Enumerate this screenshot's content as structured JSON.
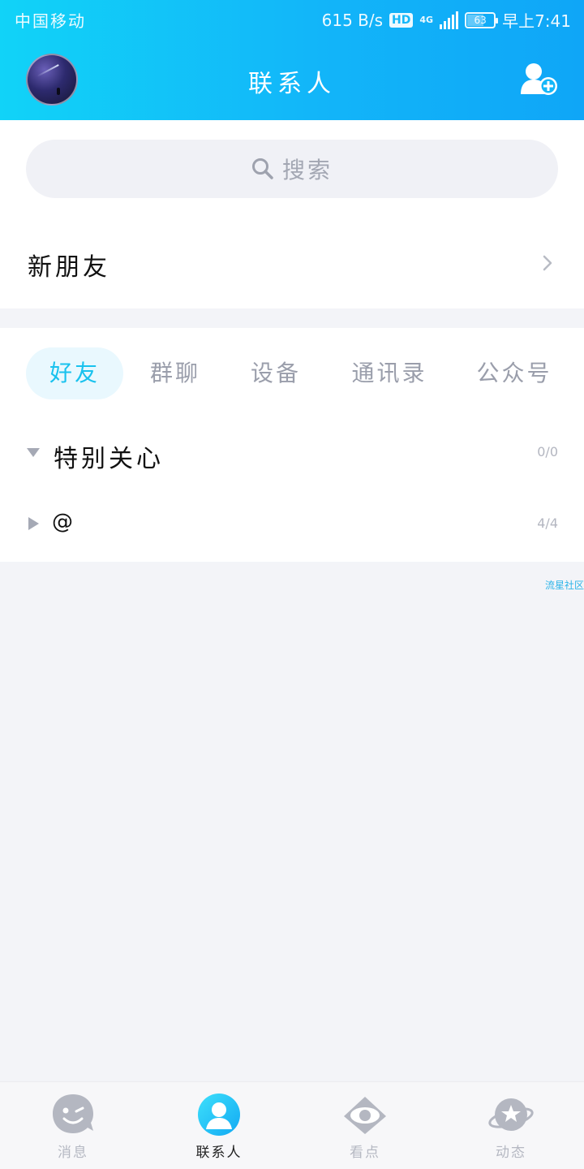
{
  "status_bar": {
    "carrier": "中国移动",
    "speed": "615 B/s",
    "hd": "HD",
    "network": "4G",
    "battery": "63",
    "time": "早上7:41"
  },
  "header": {
    "title": "联系人",
    "avatar_icon": "user-avatar",
    "add_icon": "add-contact-icon"
  },
  "search": {
    "placeholder": "搜索",
    "icon": "search-icon"
  },
  "new_friends": {
    "label": "新朋友"
  },
  "tabs": [
    {
      "label": "好友",
      "active": true
    },
    {
      "label": "群聊",
      "active": false
    },
    {
      "label": "设备",
      "active": false
    },
    {
      "label": "通讯录",
      "active": false
    },
    {
      "label": "公众号",
      "active": false
    }
  ],
  "groups": [
    {
      "name": "特别关心",
      "count": "0/0",
      "expanded": true
    },
    {
      "name": "@",
      "count": "4/4",
      "expanded": false
    }
  ],
  "watermark": "流星社区",
  "bottom_nav": [
    {
      "label": "消息",
      "icon": "message-icon",
      "active": false
    },
    {
      "label": "联系人",
      "icon": "contacts-icon",
      "active": true
    },
    {
      "label": "看点",
      "icon": "eye-icon",
      "active": false
    },
    {
      "label": "动态",
      "icon": "planet-icon",
      "active": false
    }
  ],
  "colors": {
    "header_start": "#11d3f8",
    "header_end": "#0fa6f7",
    "accent": "#19c2ee",
    "background": "#f3f4f8"
  }
}
